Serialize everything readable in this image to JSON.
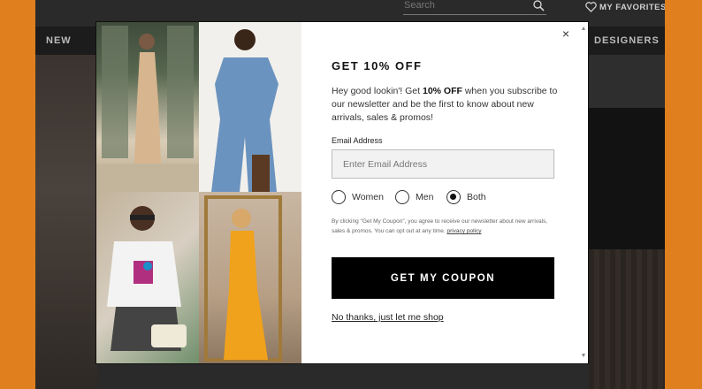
{
  "background_page": {
    "search_placeholder": "Search",
    "favorites_label": "MY FAVORITES",
    "nav_left": "NEW",
    "nav_right": "DESIGNERS"
  },
  "modal": {
    "close_glyph": "×",
    "title": "GET 10% OFF",
    "intro_prefix": "Hey good lookin'! Get ",
    "intro_bold": "10% OFF",
    "intro_suffix": " when you subscribe to our newsletter and be the first to know about new arrivals, sales & promos!",
    "email_label": "Email Address",
    "email_placeholder": "Enter Email Address",
    "email_value": "",
    "gender_options": [
      {
        "label": "Women",
        "selected": false
      },
      {
        "label": "Men",
        "selected": false
      },
      {
        "label": "Both",
        "selected": true
      }
    ],
    "legal_text": "By clicking \"Get My Coupon\", you agree to receive our newsletter about new arrivals, sales & promos. You can opt out at any time.",
    "privacy_link": "privacy policy",
    "cta_label": "GET MY COUPON",
    "decline_label": "No thanks, just let me shop"
  },
  "colors": {
    "frame_orange": "#e07f1e",
    "cta_background": "#000000",
    "cta_text": "#ffffff"
  }
}
